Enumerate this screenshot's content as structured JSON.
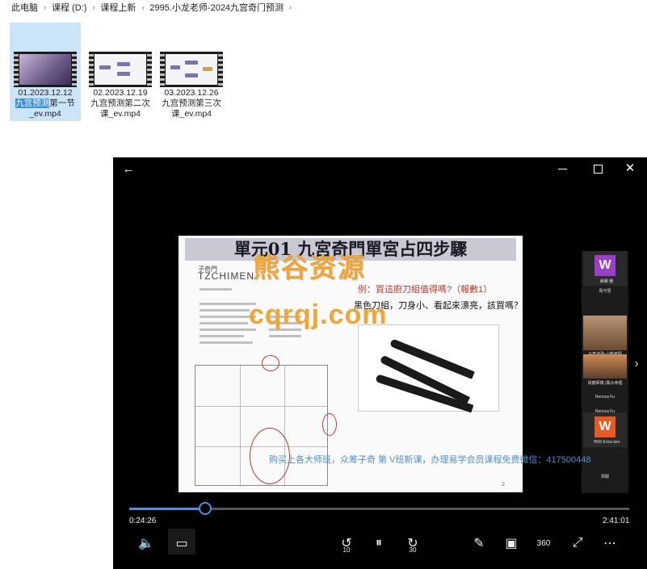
{
  "breadcrumb": [
    "此电脑",
    "课程 (D:)",
    "课程上新",
    "2995.小龙老师-2024九宫奇门预测"
  ],
  "files": [
    {
      "line1": "01.2023.12.12",
      "line2_hl": "九宫预测",
      "line2": "第一节",
      "line3": "_ev.mp4"
    },
    {
      "line1": "02.2023.12.19",
      "line2": "九宫预测第二次",
      "line3": "课_ev.mp4"
    },
    {
      "line1": "03.2023.12.26",
      "line2": "九宫预测第三次",
      "line3": "课_ev.mp4"
    }
  ],
  "player": {
    "icons": {
      "back": "back-arrow-icon",
      "minimize": "minimize-icon",
      "maximize": "maximize-icon",
      "close": "close-icon"
    },
    "current_time": "0:24:26",
    "total_time": "2:41:01",
    "progress": 0.152,
    "rewind_seconds": "10",
    "forward_seconds": "30",
    "view360": "360"
  },
  "slide": {
    "title": "單元01 九宮奇門單宮占四步驟",
    "brand_cn": "子奇門",
    "brand_en": "TZCHIMEN",
    "question": "例：買這廚刀組值得嗎?（報數1）",
    "subtext": "黑色刀組，刀身小、看起來漂亮，該買嗎？",
    "page": "2"
  },
  "participants": [
    {
      "initial": "W",
      "name": "維爾 鍾",
      "color": "#9b3fc8"
    },
    {
      "name": "馬可慧"
    },
    {
      "name": "子奇道現-小龍老師"
    },
    {
      "name": "易龍師傅 (風水命理"
    },
    {
      "name": "Nerissa Fu"
    },
    {
      "initial": "W",
      "name": "HKR Erica lam",
      "color": "#e85a23"
    },
    {
      "name": "郭穎"
    }
  ],
  "watermarks": {
    "brand": "熊谷资源",
    "site": "cqrqj.com",
    "caption": "购买上各大师班，众筹子奇 第 V班新课，办理易学会员课程免费微信：417500448"
  }
}
